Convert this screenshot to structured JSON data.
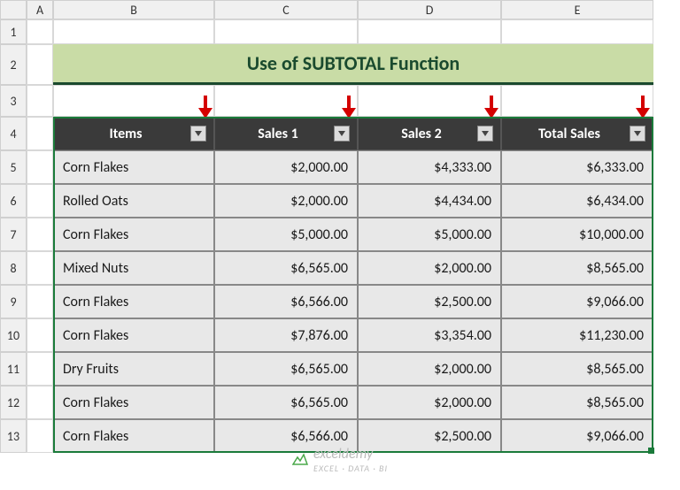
{
  "columns": [
    "A",
    "B",
    "C",
    "D",
    "E"
  ],
  "rows": [
    "1",
    "2",
    "3",
    "4",
    "5",
    "6",
    "7",
    "8",
    "9",
    "10",
    "11",
    "12",
    "13"
  ],
  "title": "Use of SUBTOTAL Function",
  "headers": {
    "items": "Items",
    "sales1": "Sales 1",
    "sales2": "Sales 2",
    "total": "Total Sales"
  },
  "rowsData": [
    {
      "item": "Corn Flakes",
      "s1": "$2,000.00",
      "s2": "$4,333.00",
      "tot": "$6,333.00"
    },
    {
      "item": "Rolled Oats",
      "s1": "$2,000.00",
      "s2": "$4,434.00",
      "tot": "$6,434.00"
    },
    {
      "item": "Corn Flakes",
      "s1": "$5,000.00",
      "s2": "$5,000.00",
      "tot": "$10,000.00"
    },
    {
      "item": "Mixed Nuts",
      "s1": "$6,565.00",
      "s2": "$2,000.00",
      "tot": "$8,565.00"
    },
    {
      "item": "Corn Flakes",
      "s1": "$6,566.00",
      "s2": "$2,500.00",
      "tot": "$9,066.00"
    },
    {
      "item": "Corn Flakes",
      "s1": "$7,876.00",
      "s2": "$3,354.00",
      "tot": "$11,230.00"
    },
    {
      "item": "Dry Fruits",
      "s1": "$6,565.00",
      "s2": "$2,000.00",
      "tot": "$8,565.00"
    },
    {
      "item": "Corn Flakes",
      "s1": "$6,565.00",
      "s2": "$2,000.00",
      "tot": "$8,565.00"
    },
    {
      "item": "Corn Flakes",
      "s1": "$6,566.00",
      "s2": "$2,500.00",
      "tot": "$9,066.00"
    }
  ],
  "watermark": {
    "brand": "exceldemy",
    "sub": "EXCEL · DATA · BI"
  },
  "chart_data": {
    "type": "table",
    "title": "Use of SUBTOTAL Function",
    "columns": [
      "Items",
      "Sales 1",
      "Sales 2",
      "Total Sales"
    ],
    "rows": [
      [
        "Corn Flakes",
        2000.0,
        4333.0,
        6333.0
      ],
      [
        "Rolled Oats",
        2000.0,
        4434.0,
        6434.0
      ],
      [
        "Corn Flakes",
        5000.0,
        5000.0,
        10000.0
      ],
      [
        "Mixed Nuts",
        6565.0,
        2000.0,
        8565.0
      ],
      [
        "Corn Flakes",
        6566.0,
        2500.0,
        9066.0
      ],
      [
        "Corn Flakes",
        7876.0,
        3354.0,
        11230.0
      ],
      [
        "Dry Fruits",
        6565.0,
        2000.0,
        8565.0
      ],
      [
        "Corn Flakes",
        6565.0,
        2000.0,
        8565.0
      ],
      [
        "Corn Flakes",
        6566.0,
        2500.0,
        9066.0
      ]
    ]
  }
}
